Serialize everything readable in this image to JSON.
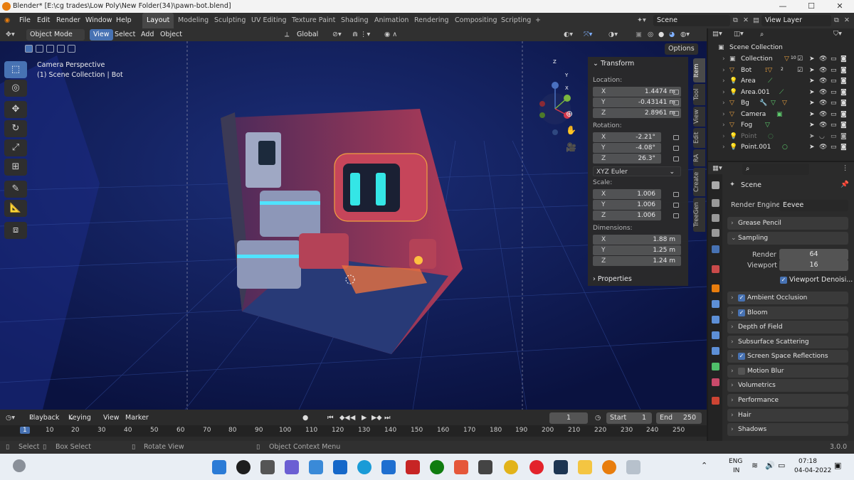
{
  "window": {
    "title": "Blender* [E:\\cg trades\\Low Poly\\New Folder(34)\\pawn-bot.blend]"
  },
  "menu": [
    "File",
    "Edit",
    "Render",
    "Window",
    "Help"
  ],
  "workspaces": [
    "Layout",
    "Modeling",
    "Sculpting",
    "UV Editing",
    "Texture Paint",
    "Shading",
    "Animation",
    "Rendering",
    "Compositing",
    "Scripting",
    "+"
  ],
  "scene_field": "Scene",
  "view_layer_field": "View Layer",
  "viewport_header": {
    "mode": "Object Mode",
    "view": "View",
    "select": "Select",
    "add": "Add",
    "object": "Object",
    "orientation": "Global",
    "options": "Options"
  },
  "viewport": {
    "camera_label": "Camera Perspective",
    "collection_label": "(1) Scene Collection | Bot"
  },
  "gizmo": {
    "z": "Z",
    "y": "Y",
    "x": "X"
  },
  "npanel": {
    "transform_label": "Transform",
    "location_label": "Location:",
    "location": [
      {
        "axis": "X",
        "value": "1.4474 m"
      },
      {
        "axis": "Y",
        "value": "-0.43141 m"
      },
      {
        "axis": "Z",
        "value": "2.8961 m"
      }
    ],
    "rotation_label": "Rotation:",
    "rotation": [
      {
        "axis": "X",
        "value": "-2.21°"
      },
      {
        "axis": "Y",
        "value": "-4.08°"
      },
      {
        "axis": "Z",
        "value": "26.3°"
      }
    ],
    "rotation_mode": "XYZ Euler",
    "scale_label": "Scale:",
    "scale": [
      {
        "axis": "X",
        "value": "1.006"
      },
      {
        "axis": "Y",
        "value": "1.006"
      },
      {
        "axis": "Z",
        "value": "1.006"
      }
    ],
    "dimensions_label": "Dimensions:",
    "dimensions": [
      {
        "axis": "X",
        "value": "1.88 m"
      },
      {
        "axis": "Y",
        "value": "1.25 m"
      },
      {
        "axis": "Z",
        "value": "1.24 m"
      }
    ],
    "properties_label": "Properties"
  },
  "side_tabs": [
    "Item",
    "Tool",
    "View",
    "Edit",
    "RA",
    "Create",
    "TreeGen"
  ],
  "outliner": {
    "root": "Scene Collection",
    "items": [
      "Collection",
      "Bot",
      "Area",
      "Area.001",
      "Bg",
      "Camera",
      "Fog",
      "Point",
      "Point.001"
    ],
    "badge_collection": "10",
    "badge_bot": "2"
  },
  "properties": {
    "scene_label": "Scene",
    "render_engine_label": "Render Engine",
    "render_engine": "Eevee",
    "sampling": {
      "label": "Sampling",
      "render_label": "Render",
      "render": "64",
      "viewport_label": "Viewport",
      "viewport": "16",
      "denoise": "Viewport Denoisi..."
    },
    "sections": [
      "Grease Pencil",
      "Ambient Occlusion",
      "Bloom",
      "Depth of Field",
      "Subsurface Scattering",
      "Screen Space Reflections",
      "Motion Blur",
      "Volumetrics",
      "Performance",
      "Hair",
      "Shadows"
    ]
  },
  "timeline": {
    "menus": [
      "Playback",
      "Keying",
      "View",
      "Marker"
    ],
    "current_frame": "1",
    "start_label": "Start",
    "start": "1",
    "end_label": "End",
    "end": "250",
    "ticks": [
      "1",
      "10",
      "20",
      "30",
      "40",
      "50",
      "60",
      "70",
      "80",
      "90",
      "100",
      "110",
      "120",
      "130",
      "140",
      "150",
      "160",
      "170",
      "180",
      "190",
      "200",
      "210",
      "220",
      "230",
      "240",
      "250"
    ]
  },
  "statusbar": {
    "select": "Select",
    "box_select": "Box Select",
    "rotate": "Rotate View",
    "context": "Object Context Menu",
    "version": "3.0.0"
  },
  "taskbar": {
    "lang": "ENG",
    "region": "IN",
    "time": "07:18",
    "date": "04-04-2022"
  },
  "colors": {
    "accent": "#4772b3",
    "viewport_bg": "#0f1c4e",
    "robot_red": "#c6455a",
    "screen_cyan": "#34e6e6"
  }
}
